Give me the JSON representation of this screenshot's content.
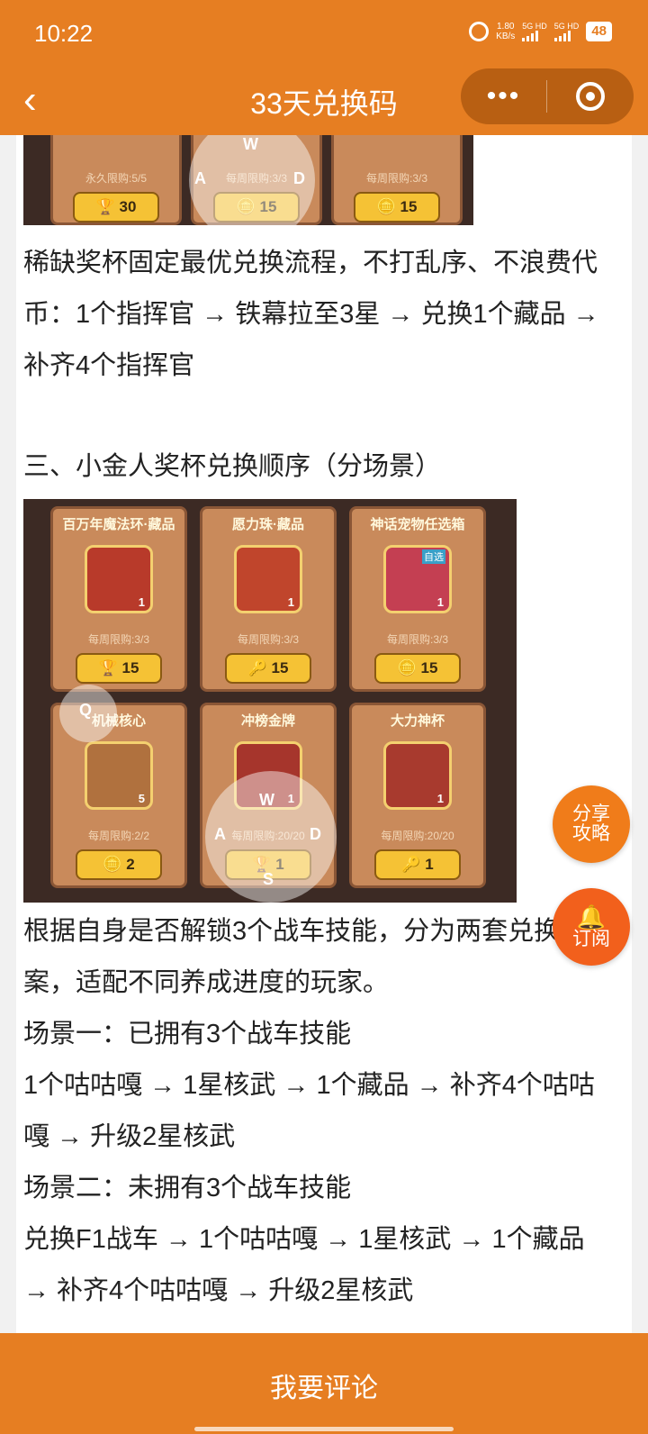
{
  "status": {
    "time": "10:22",
    "net_speed": "1.80",
    "net_unit": "KB/s",
    "sim1": "5G HD",
    "sim2": "5G HD",
    "battery": "48"
  },
  "nav": {
    "back_icon": "chevron-left-icon",
    "title": "33天兑换码",
    "more_icon": "•••",
    "target_icon": "target-icon"
  },
  "shot1": {
    "cards": [
      {
        "limit": "永久限购:5/5",
        "price": "30"
      },
      {
        "limit": "每周限购:3/3",
        "price": "15"
      },
      {
        "limit": "每周限购:3/3",
        "price": "15"
      }
    ],
    "joystick": {
      "w": "W",
      "a": "A",
      "d": "D"
    }
  },
  "para1": "稀缺奖杯固定最优兑换流程，不打乱序、不浪费代币：1个指挥官 → 铁幕拉至3星 → 兑换1个藏品 → 补齐4个指挥官",
  "heading3": "三、小金人奖杯兑换顺序（分场景）",
  "shot2": {
    "cards": [
      {
        "title": "百万年魔法环·藏品",
        "qty": "1",
        "limit": "每周限购:3/3",
        "price": "15",
        "color": "#b83a2a"
      },
      {
        "title": "愿力珠·藏品",
        "qty": "1",
        "limit": "每周限购:3/3",
        "price": "15",
        "color": "#c0452c"
      },
      {
        "title": "神话宠物任选箱",
        "qty": "1",
        "limit": "每周限购:3/3",
        "price": "15",
        "color": "#c43f52",
        "badge": "自选"
      },
      {
        "title": "机械核心",
        "qty": "5",
        "limit": "每周限购:2/2",
        "price": "2",
        "color": "#b0713e"
      },
      {
        "title": "冲榜金牌",
        "qty": "1",
        "limit": "每周限购:20/20",
        "price": "1",
        "color": "#a6352c"
      },
      {
        "title": "大力神杯",
        "qty": "1",
        "limit": "每周限购:20/20",
        "price": "1",
        "color": "#a83a2e"
      }
    ],
    "joystick": {
      "w": "W",
      "a": "A",
      "d": "D",
      "s": "S",
      "q": "Q"
    }
  },
  "para2": "根据自身是否解锁3个战车技能，分为两套兑换方案，适配不同养成进度的玩家。",
  "scene1_title": "场景一：已拥有3个战车技能",
  "scene1_body": "1个咕咕嘎 → 1星核武 → 1个藏品 → 补齐4个咕咕嘎 → 升级2星核武",
  "scene2_title": "场景二：未拥有3个战车技能",
  "scene2_body": "兑换F1战车 → 1个咕咕嘎 → 1星核武 → 1个藏品 → 补齐4个咕咕嘎 → 升级2星核武",
  "fab_share": {
    "line1": "分享",
    "line2": "攻略"
  },
  "fab_subscribe": {
    "icon": "bell-icon",
    "label": "订阅"
  },
  "bottom": {
    "comment_label": "我要评论"
  }
}
